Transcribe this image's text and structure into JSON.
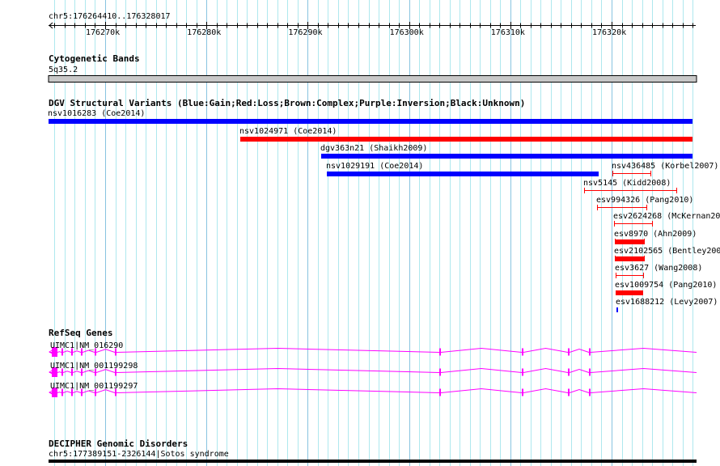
{
  "ruler": {
    "location": "chr5:176264410..176328017",
    "start": 176264410,
    "end": 176328017,
    "tick_labels": [
      "176270k",
      "176280k",
      "176290k",
      "176300k",
      "176310k",
      "176320k"
    ],
    "ticks": [
      176270000,
      176280000,
      176290000,
      176300000,
      176310000,
      176320000
    ]
  },
  "cytobands": {
    "title": "Cytogenetic Bands",
    "band": "5q35.2",
    "color": "#c8c8c8"
  },
  "dgv": {
    "title": "DGV Structural Variants (Blue:Gain;Red:Loss;Brown:Complex;Purple:Inversion;Black:Unknown)",
    "features": [
      {
        "label": "nsv1016283 (Coe2014)",
        "start": 176264410,
        "end": 176328017,
        "type": "gain",
        "style": "thick",
        "row": 0
      },
      {
        "label": "nsv1024971 (Coe2014)",
        "start": 176283340,
        "end": 176328017,
        "type": "loss",
        "style": "thick",
        "row": 1
      },
      {
        "label": "dgv363n21 (Shaikh2009)",
        "start": 176291330,
        "end": 176328017,
        "type": "gain",
        "style": "thick",
        "row": 2
      },
      {
        "label": "nsv1029191 (Coe2014)",
        "start": 176291890,
        "end": 176318720,
        "type": "gain",
        "style": "thick",
        "row": 3
      },
      {
        "label": "nsv436485 (Korbel2007)",
        "start": 176320080,
        "end": 176323910,
        "type": "loss",
        "style": "thin",
        "row": 3
      },
      {
        "label": "nsv5145 (Kidd2008)",
        "start": 176317290,
        "end": 176326470,
        "type": "loss",
        "style": "thin",
        "row": 4
      },
      {
        "label": "esv994326 (Pang2010)",
        "start": 176318560,
        "end": 176323510,
        "type": "loss",
        "style": "thin",
        "row": 5
      },
      {
        "label": "esv2624268 (McKernan2009)",
        "start": 176320240,
        "end": 176324070,
        "type": "loss",
        "style": "thin",
        "row": 6
      },
      {
        "label": "esv8970 (Ahn2009)",
        "start": 176320320,
        "end": 176323270,
        "type": "loss",
        "style": "capped",
        "row": 7
      },
      {
        "label": "esv2102565 (Bentley2008)",
        "start": 176320320,
        "end": 176323270,
        "type": "loss",
        "style": "capped",
        "row": 8
      },
      {
        "label": "esv3627 (Wang2008)",
        "start": 176320400,
        "end": 176323190,
        "type": "loss",
        "style": "thin",
        "row": 9
      },
      {
        "label": "esv1009754 (Pang2010)",
        "start": 176320400,
        "end": 176323110,
        "type": "loss",
        "style": "thick",
        "row": 10
      },
      {
        "label": "esv1688212 (Levy2007)",
        "start": 176320480,
        "end": 176320560,
        "type": "gain",
        "style": "thick",
        "row": 11
      }
    ],
    "colors": {
      "gain": "#0000ff",
      "loss": "#ff0000"
    }
  },
  "refseq": {
    "title": "RefSeq Genes",
    "color": "#ff00ff",
    "genes": [
      {
        "label": "UIMC1|NM_016290"
      },
      {
        "label": "UIMC1|NM_001199298"
      },
      {
        "label": "UIMC1|NM_001199297"
      }
    ],
    "exons_bp": [
      [
        176264700,
        176265250
      ],
      [
        176265700,
        176265800
      ],
      [
        176266650,
        176266750
      ],
      [
        176267600,
        176267700
      ],
      [
        176268950,
        176269050
      ],
      [
        176270950,
        176271050
      ],
      [
        176303000,
        176303100
      ],
      [
        176311150,
        176311250
      ],
      [
        176315700,
        176315800
      ],
      [
        176317780,
        176317880
      ]
    ]
  },
  "decipher": {
    "title": "DECIPHER Genomic Disorders",
    "feature": "chr5:177389151-2326144|Sotos syndrome"
  }
}
